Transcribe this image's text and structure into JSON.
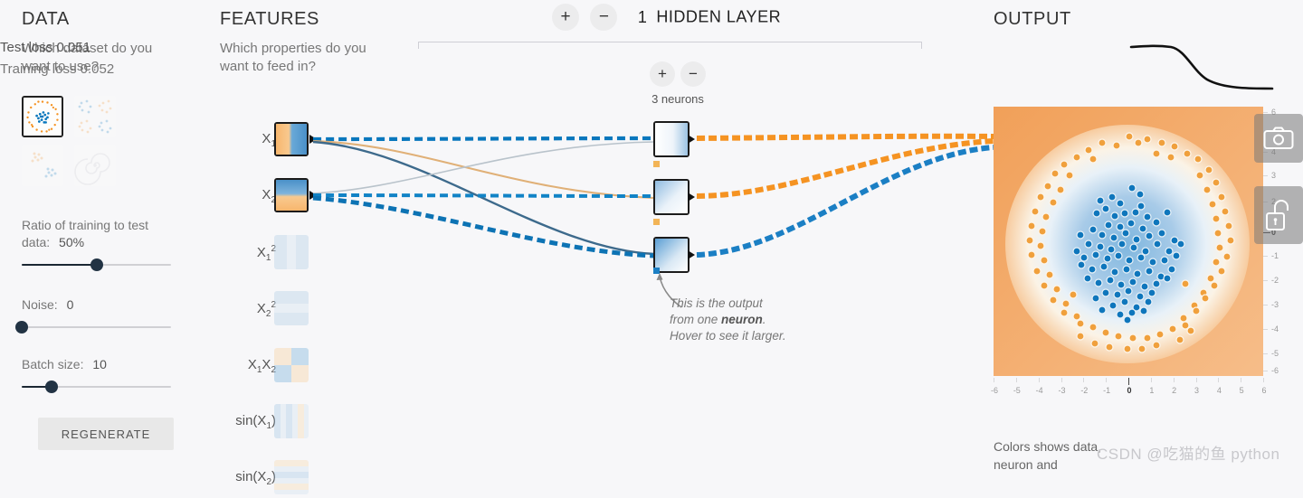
{
  "data_panel": {
    "title": "DATA",
    "question": "Which dataset do you want to use?",
    "datasets": [
      {
        "name": "circle",
        "selected": true
      },
      {
        "name": "exclusive-or",
        "selected": false
      },
      {
        "name": "gaussian",
        "selected": false
      },
      {
        "name": "spiral",
        "selected": false
      }
    ],
    "ratio": {
      "label": "Ratio of training to test data:",
      "value": "50%",
      "percent": 50
    },
    "noise": {
      "label": "Noise:",
      "value": "0",
      "percent": 0
    },
    "batch": {
      "label": "Batch size:",
      "value": "10",
      "percent": 20
    },
    "regenerate_label": "REGENERATE"
  },
  "features_panel": {
    "title": "FEATURES",
    "question": "Which properties do you want to feed in?",
    "features": [
      {
        "label": "X",
        "sub": "1",
        "sup": "",
        "active": true
      },
      {
        "label": "X",
        "sub": "2",
        "sup": "",
        "active": true
      },
      {
        "label": "X",
        "sub": "1",
        "sup": "2",
        "active": false
      },
      {
        "label": "X",
        "sub": "2",
        "sup": "2",
        "active": false
      },
      {
        "label": "X₁X₂",
        "sub": "",
        "sup": "",
        "active": false
      },
      {
        "label": "sin(X₁)",
        "sub": "",
        "sup": "",
        "active": false
      },
      {
        "label": "sin(X₂)",
        "sub": "",
        "sup": "",
        "active": false
      }
    ]
  },
  "network_panel": {
    "add_layer_label": "+",
    "remove_layer_label": "−",
    "layer_count": "1",
    "layer_word": "HIDDEN LAYER",
    "add_neuron_label": "+",
    "remove_neuron_label": "−",
    "neuron_count_label": "3 neurons",
    "callout": {
      "line1": "This is the output",
      "line2": "from one",
      "bold": "neuron",
      "line3": ". Hover",
      "line4": "to see it larger."
    }
  },
  "output_panel": {
    "title": "OUTPUT",
    "test_loss": "Test loss 0.051",
    "training_loss": "Training loss 0.052",
    "x_ticks": [
      "-6",
      "-5",
      "-4",
      "-3",
      "-2",
      "-1",
      "0",
      "1",
      "2",
      "3",
      "4",
      "5",
      "6"
    ],
    "y_ticks": [
      "6",
      "4",
      "3",
      "2",
      "0",
      "-1",
      "-2",
      "-3",
      "-4",
      "-5",
      "-6"
    ],
    "note": "Colors shows data, neuron and"
  },
  "overlay": {
    "camera_icon": "camera-icon",
    "lock_icon": "unlock-icon"
  },
  "watermark": "CSDN @吃猫的鱼 python",
  "colors": {
    "positive": "#f59322",
    "negative": "#0877bd",
    "background": "#f7f7f9",
    "text": "#333333",
    "muted": "#777777"
  }
}
